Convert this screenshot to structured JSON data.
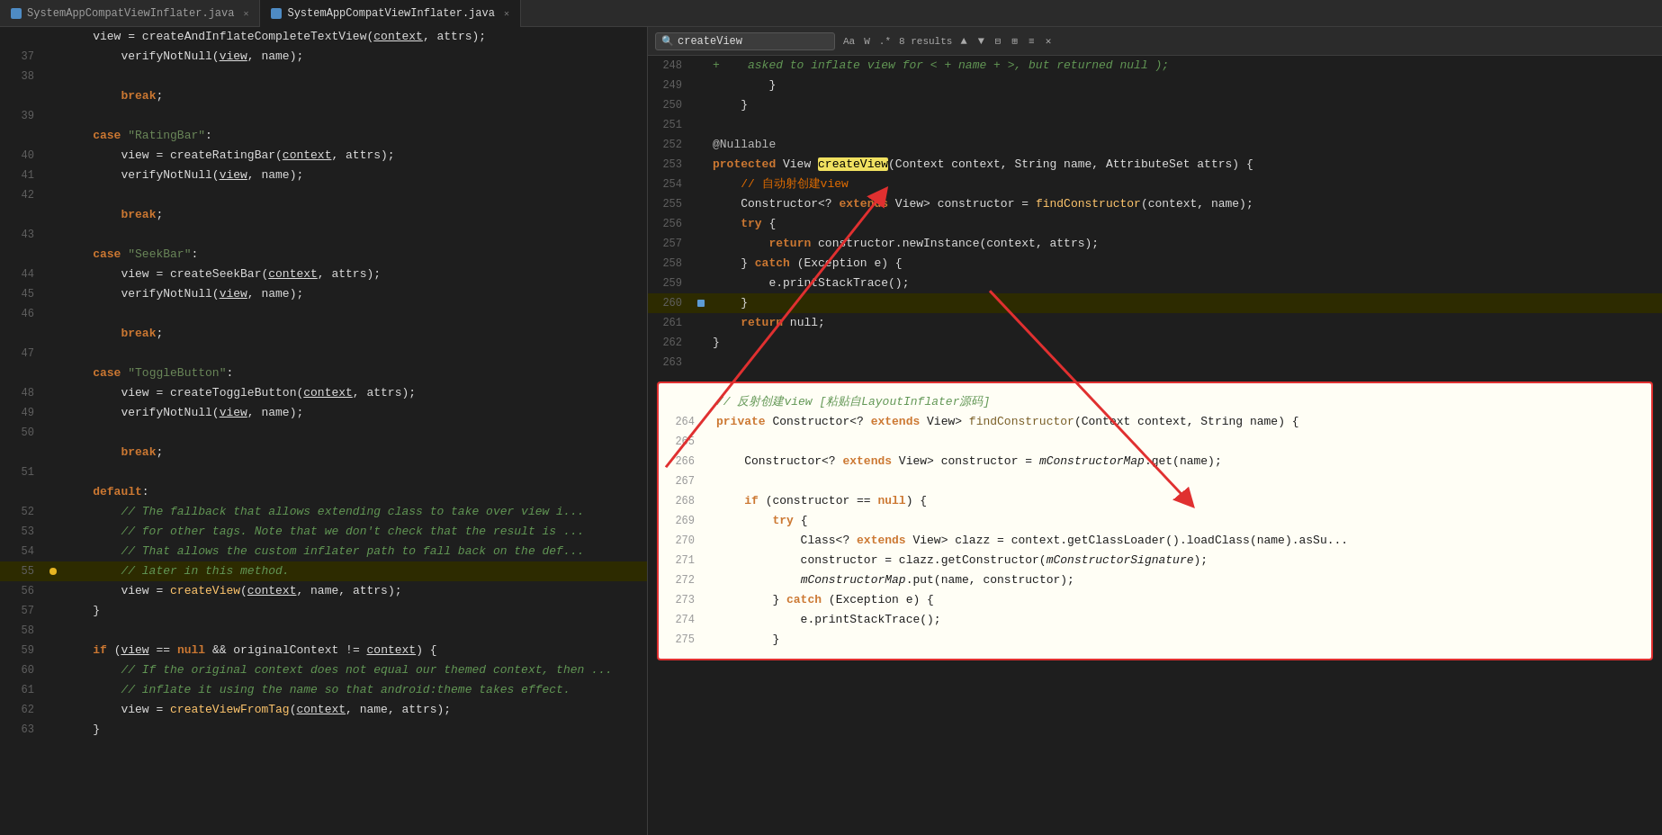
{
  "tabs": {
    "left": {
      "label": "SystemAppCompatViewInflater.java",
      "active": false
    },
    "right": {
      "label": "SystemAppCompatViewInflater.java",
      "active": true
    }
  },
  "search": {
    "query": "createView",
    "results_count": "8 results",
    "placeholder": "createView"
  },
  "left_panel": {
    "lines": [
      {
        "num": "",
        "code": "    view = createAndInflateCompleteTextView(context, attrs);",
        "indent": 2
      },
      {
        "num": "37",
        "code": "        verifyNotNull(view, name);"
      },
      {
        "num": "38",
        "code": ""
      },
      {
        "num": "",
        "code": "        break;"
      },
      {
        "num": "39",
        "code": ""
      },
      {
        "num": "",
        "code": "    case \"RatingBar\":"
      },
      {
        "num": "40",
        "code": "        view = createRatingBar(context, attrs);"
      },
      {
        "num": "41",
        "code": "        verifyNotNull(view, name);"
      },
      {
        "num": "42",
        "code": ""
      },
      {
        "num": "",
        "code": "        break;"
      },
      {
        "num": "43",
        "code": ""
      },
      {
        "num": "",
        "code": "    case \"SeekBar\":"
      },
      {
        "num": "44",
        "code": "        view = createSeekBar(context, attrs);"
      },
      {
        "num": "45",
        "code": "        verifyNotNull(view, name);"
      },
      {
        "num": "46",
        "code": ""
      },
      {
        "num": "",
        "code": "        break;"
      },
      {
        "num": "47",
        "code": ""
      },
      {
        "num": "",
        "code": "    case \"ToggleButton\":"
      },
      {
        "num": "48",
        "code": "        view = createToggleButton(context, attrs);"
      },
      {
        "num": "49",
        "code": "        verifyNotNull(view, name);"
      },
      {
        "num": "50",
        "code": ""
      },
      {
        "num": "",
        "code": "        break;"
      },
      {
        "num": "51",
        "code": ""
      },
      {
        "num": "",
        "code": "    default:"
      },
      {
        "num": "52",
        "code": "        // The fallback that allows extending class to take over view i..."
      },
      {
        "num": "53",
        "code": "        // for other tags. Note that we don't check that the result is ..."
      },
      {
        "num": "54",
        "code": "        // That allows the custom inflater path to fall back on the def..."
      },
      {
        "num": "55",
        "code": "        // later in this method.",
        "highlight": true
      },
      {
        "num": "56",
        "code": "        view = createView(context, name, attrs);"
      },
      {
        "num": "57",
        "code": "    }"
      },
      {
        "num": "58",
        "code": ""
      },
      {
        "num": "59",
        "code": "    if (view == null && originalContext != context) {"
      },
      {
        "num": "60",
        "code": "        // If the original context does not equal our themed context, then ..."
      },
      {
        "num": "61",
        "code": "        // inflate it using the name so that android:theme takes effect."
      },
      {
        "num": "62",
        "code": "        view = createViewFromTag(context, name, attrs);"
      },
      {
        "num": "63",
        "code": "    }"
      }
    ]
  },
  "right_panel": {
    "lines": [
      {
        "num": "248",
        "code": "+    asked to inflate view for < + name + >, but returned null );",
        "type": "comment"
      },
      {
        "num": "249",
        "code": "        }"
      },
      {
        "num": "250",
        "code": "    }"
      },
      {
        "num": "251",
        "code": ""
      },
      {
        "num": "252",
        "code": "@Nullable"
      },
      {
        "num": "253",
        "code": "protected View createView(Context context, String name, AttributeSet attrs) {"
      },
      {
        "num": "254",
        "code": "    // 自动射创建view",
        "type": "comment_cn"
      },
      {
        "num": "255",
        "code": "    Constructor<? extends View> constructor = findConstructor(context, name);"
      },
      {
        "num": "256",
        "code": "    try {"
      },
      {
        "num": "257",
        "code": "        return constructor.newInstance(context, attrs);"
      },
      {
        "num": "258",
        "code": "    } catch (Exception e) {"
      },
      {
        "num": "259",
        "code": "        e.printStackTrace();"
      },
      {
        "num": "260",
        "code": "    }",
        "highlight": true
      },
      {
        "num": "261",
        "code": "    return null;"
      },
      {
        "num": "262",
        "code": "}"
      },
      {
        "num": "263",
        "code": ""
      }
    ]
  },
  "annotation_block": {
    "comment": "// 反射创建view [粘贴自LayoutInflater源码]",
    "lines": [
      {
        "num": "264",
        "code": "private Constructor<? extends View> findConstructor(Context context, String name) {"
      },
      {
        "num": "265",
        "code": ""
      },
      {
        "num": "266",
        "code": "    Constructor<? extends View> constructor = mConstructorMap.get(name);"
      },
      {
        "num": "267",
        "code": ""
      },
      {
        "num": "268",
        "code": "    if (constructor == null) {"
      },
      {
        "num": "269",
        "code": "        try {"
      },
      {
        "num": "270",
        "code": "            Class<? extends View> clazz = context.getClassLoader().loadClass(name).asSu..."
      },
      {
        "num": "271",
        "code": "            constructor = clazz.getConstructor(mConstructorSignature);"
      },
      {
        "num": "272",
        "code": "            mConstructorMap.put(name, constructor);"
      },
      {
        "num": "273",
        "code": "        } catch (Exception e) {"
      },
      {
        "num": "274",
        "code": "            e.printStackTrace();"
      },
      {
        "num": "275",
        "code": "        }"
      }
    ]
  }
}
